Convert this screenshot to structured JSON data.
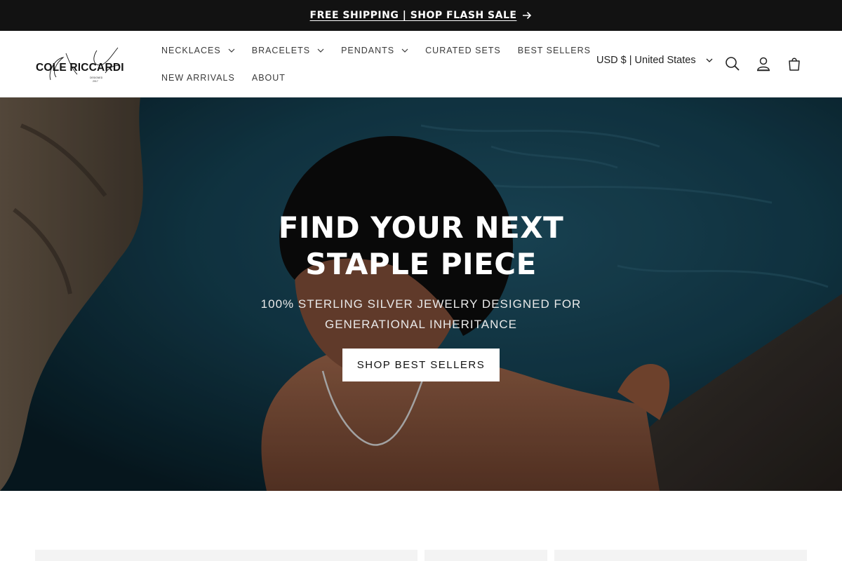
{
  "announcement": {
    "text": "FREE SHIPPING | SHOP FLASH SALE",
    "arrow_icon": "arrow-right-icon"
  },
  "header": {
    "logo_text": "COLE RICCARDI",
    "nav": {
      "row1": [
        {
          "label": "NECKLACES",
          "dropdown": true
        },
        {
          "label": "BRACELETS",
          "dropdown": true
        },
        {
          "label": "PENDANTS",
          "dropdown": true
        },
        {
          "label": "CURATED SETS",
          "dropdown": false
        },
        {
          "label": "BEST SELLERS",
          "dropdown": false
        }
      ],
      "row2": [
        {
          "label": "NEW ARRIVALS",
          "dropdown": false
        },
        {
          "label": "ABOUT",
          "dropdown": false
        }
      ]
    },
    "currency": "USD $ | United States",
    "icons": [
      "search-icon",
      "account-icon",
      "cart-icon"
    ]
  },
  "hero": {
    "title_line1": "FIND YOUR NEXT",
    "title_line2": "STAPLE PIECE",
    "subtitle_line1": "100% STERLING SILVER JEWELRY DESIGNED FOR",
    "subtitle_line2": "GENERATIONAL INHERITANCE",
    "button": "SHOP BEST SELLERS"
  },
  "colors": {
    "announcement_bg": "#121212",
    "hero_water": "#0d2a36",
    "button_bg": "#ffffff"
  }
}
